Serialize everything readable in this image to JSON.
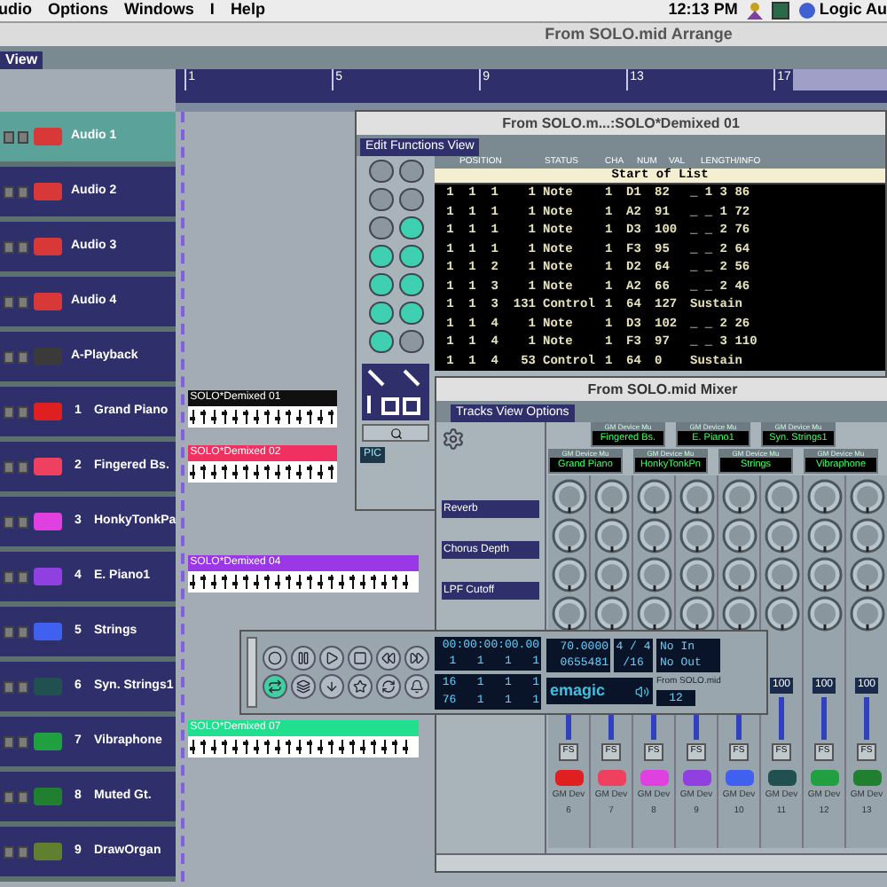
{
  "menu_bar": {
    "menus": [
      "udio",
      "Options",
      "Windows",
      "I",
      "Help"
    ],
    "clock": "12:13 PM",
    "app": "Logic Au"
  },
  "arrange": {
    "title": "From SOLO.mid Arrange",
    "view_tab": "View",
    "ruler": [
      "1",
      "5",
      "9",
      "13",
      "17"
    ],
    "tracks": [
      {
        "name": "Audio 1",
        "selected": true,
        "color": "#d83838"
      },
      {
        "name": "Audio 2",
        "selected": false,
        "color": "#d83838"
      },
      {
        "name": "Audio 3",
        "selected": false,
        "color": "#d83838"
      },
      {
        "name": "Audio 4",
        "selected": false,
        "color": "#d83838"
      },
      {
        "name": "A-Playback",
        "selected": false,
        "color": "#3a3a3a"
      },
      {
        "number": "1",
        "name": "Grand Piano",
        "selected": false,
        "color": "#e02020",
        "region": {
          "name": "SOLO*Demixed 01",
          "color": "#101010"
        }
      },
      {
        "number": "2",
        "name": "Fingered Bs.",
        "selected": false,
        "color": "#f04060",
        "region": {
          "name": "SOLO*Demixed 02",
          "color": "#f03060"
        }
      },
      {
        "number": "3",
        "name": "HonkyTonkPa",
        "selected": false,
        "color": "#e040e0"
      },
      {
        "number": "4",
        "name": "E. Piano1",
        "selected": false,
        "color": "#9040e0",
        "region": {
          "name": "SOLO*Demixed 04",
          "color": "#9a38e8"
        }
      },
      {
        "number": "5",
        "name": "Strings",
        "selected": false,
        "color": "#4060f0"
      },
      {
        "number": "6",
        "name": "Syn. Strings1",
        "selected": false,
        "color": "#205050"
      },
      {
        "number": "7",
        "name": "Vibraphone",
        "selected": false,
        "color": "#20a040",
        "region": {
          "name": "SOLO*Demixed 07",
          "color": "#20e090"
        }
      },
      {
        "number": "8",
        "name": "Muted Gt.",
        "selected": false,
        "color": "#208030"
      },
      {
        "number": "9",
        "name": "DrawOrgan",
        "selected": false,
        "color": "#608030"
      }
    ]
  },
  "event_list": {
    "title": "From SOLO.m...:SOLO*Demixed 01",
    "tab": "Edit Functions View",
    "columns": [
      "POSITION",
      "STATUS",
      "CHA",
      "NUM",
      "VAL",
      "LENGTH/INFO"
    ],
    "start_label": "Start of List",
    "tools": [
      {
        "active": false
      },
      {
        "active": false
      },
      {
        "active": false
      },
      {
        "active": false
      },
      {
        "active": false
      },
      {
        "active": true
      },
      {
        "active": true
      },
      {
        "active": true
      },
      {
        "active": true
      },
      {
        "active": true
      },
      {
        "active": true
      },
      {
        "active": true
      },
      {
        "active": true
      },
      {
        "active": false
      }
    ],
    "pic_label": "PIC",
    "events": [
      {
        "position": "1  1  1    1",
        "status": "Note",
        "cha": "1",
        "num": "D1",
        "val": "82",
        "length": "_ 1 3 86"
      },
      {
        "position": "1  1  1    1",
        "status": "Note",
        "cha": "1",
        "num": "A2",
        "val": "91",
        "length": "_ _ 1 72"
      },
      {
        "position": "1  1  1    1",
        "status": "Note",
        "cha": "1",
        "num": "D3",
        "val": "100",
        "length": "_ _ 2 76"
      },
      {
        "position": "1  1  1    1",
        "status": "Note",
        "cha": "1",
        "num": "F3",
        "val": "95",
        "length": "_ _ 2 64"
      },
      {
        "position": "1  1  2    1",
        "status": "Note",
        "cha": "1",
        "num": "D2",
        "val": "64",
        "length": "_ _ 2 56"
      },
      {
        "position": "1  1  3    1",
        "status": "Note",
        "cha": "1",
        "num": "A2",
        "val": "66",
        "length": "_ _ 2 46"
      },
      {
        "position": "1  1  3  131",
        "status": "Control",
        "cha": "1",
        "num": "64",
        "val": "127",
        "length": "Sustain"
      },
      {
        "position": "1  1  4    1",
        "status": "Note",
        "cha": "1",
        "num": "D3",
        "val": "102",
        "length": "_ _ 2 26"
      },
      {
        "position": "1  1  4    1",
        "status": "Note",
        "cha": "1",
        "num": "F3",
        "val": "97",
        "length": "_ _ 3 110"
      },
      {
        "position": "1  1  4   53",
        "status": "Control",
        "cha": "1",
        "num": "64",
        "val": "0",
        "length": "Sustain"
      }
    ]
  },
  "mixer": {
    "title": "From SOLO.mid Mixer",
    "tab": "Tracks View Options",
    "sends": [
      "Reverb",
      "Chorus Depth",
      "LPF Cutoff"
    ],
    "strips": [
      {
        "device": "GM Device Mu",
        "name": "Grand Piano",
        "kind": "lower",
        "button": "FS",
        "color": "#e02020",
        "output": "GM Dev",
        "channel": "6"
      },
      {
        "device": "GM Device Mu",
        "name": "Fingered Bs.",
        "kind": "upper",
        "button": "FS",
        "color": "#f04060",
        "output": "GM Dev",
        "channel": "7"
      },
      {
        "device": "GM Device Mu",
        "name": "HonkyTonkPn",
        "kind": "lower",
        "button": "FS",
        "color": "#e040e0",
        "output": "GM Dev",
        "channel": "8"
      },
      {
        "device": "GM Device Mu",
        "name": "E. Piano1",
        "kind": "upper",
        "button": "FS",
        "color": "#9040e0",
        "output": "GM Dev",
        "channel": "9"
      },
      {
        "device": "GM Device Mu",
        "name": "Strings",
        "kind": "lower",
        "button": "FS",
        "color": "#4060f0",
        "output": "GM Dev",
        "channel": "10"
      },
      {
        "device": "GM Device Mu",
        "name": "Syn. Strings1",
        "kind": "upper",
        "button": "FS",
        "volume": "100",
        "color": "#205050",
        "output": "GM Dev",
        "channel": "11"
      },
      {
        "device": "GM Device Mu",
        "name": "Vibraphone",
        "kind": "lower",
        "button": "FS",
        "volume": "100",
        "color": "#20a040",
        "output": "GM Dev",
        "channel": "12"
      },
      {
        "kind": "upper",
        "button": "FS",
        "volume": "100",
        "color": "#208030",
        "output": "GM Dev",
        "channel": "13"
      }
    ]
  },
  "transport": {
    "buttons": [
      {
        "kind": "record",
        "on": false
      },
      {
        "kind": "pause",
        "on": false
      },
      {
        "kind": "play",
        "on": false
      },
      {
        "kind": "stop",
        "on": false
      },
      {
        "kind": "rewind",
        "on": false
      },
      {
        "kind": "forward",
        "on": false
      },
      {
        "kind": "cycle",
        "on": true
      },
      {
        "kind": "replace",
        "on": false
      },
      {
        "kind": "drop",
        "on": false
      },
      {
        "kind": "solo",
        "on": false
      },
      {
        "kind": "sync",
        "on": false
      },
      {
        "kind": "click",
        "on": false
      }
    ],
    "smpte": "00:00:00:00.00",
    "bar": "1   1   1   1",
    "left_locator": "16   1   1   1",
    "right_locator": "76   1   1   1",
    "tempo": "70.0000",
    "ticks": "0655481",
    "signature": "4 / 4",
    "division": "/16",
    "midi_in": "No In",
    "midi_out": "No Out",
    "brand": "emagic",
    "song": "From SOLO.mid",
    "value": "12"
  }
}
